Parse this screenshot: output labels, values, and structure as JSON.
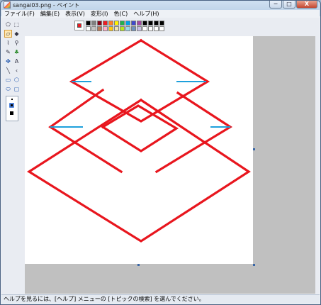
{
  "window": {
    "title": "sangai03.png - ペイント",
    "controls": {
      "minimize": "─",
      "maximize": "□",
      "close": "X"
    }
  },
  "menu": [
    {
      "label": "ファイル(F)"
    },
    {
      "label": "編集(E)"
    },
    {
      "label": "表示(V)"
    },
    {
      "label": "変形(I)"
    },
    {
      "label": "色(C)"
    },
    {
      "label": "ヘルプ(H)"
    }
  ],
  "tools": [
    {
      "name": "free-select-icon",
      "glyph": "⬠"
    },
    {
      "name": "rect-select-icon",
      "glyph": "⬚"
    },
    {
      "name": "eraser-icon",
      "glyph": "▱"
    },
    {
      "name": "fill-icon",
      "glyph": "◆"
    },
    {
      "name": "color-picker-icon",
      "glyph": "⌇"
    },
    {
      "name": "magnifier-icon",
      "glyph": "⚲"
    },
    {
      "name": "pencil-icon",
      "glyph": "✎"
    },
    {
      "name": "brush-icon",
      "glyph": "♣"
    },
    {
      "name": "airbrush-icon",
      "glyph": "✤"
    },
    {
      "name": "text-icon",
      "glyph": "A"
    },
    {
      "name": "line-icon",
      "glyph": "╲"
    },
    {
      "name": "curve-icon",
      "glyph": "‹"
    },
    {
      "name": "rectangle-icon",
      "glyph": "▭"
    },
    {
      "name": "polygon-icon",
      "glyph": "⬡"
    },
    {
      "name": "ellipse-icon",
      "glyph": "⬭"
    },
    {
      "name": "rounded-rect-icon",
      "glyph": "▢"
    }
  ],
  "palette": {
    "foreground": "#ed1c24",
    "colors": [
      "#000000",
      "#7f7f7f",
      "#880015",
      "#ed1c24",
      "#ff7f27",
      "#fff200",
      "#22b14c",
      "#00a2e8",
      "#3f48cc",
      "#a349a4",
      "#000000",
      "#000000",
      "#000000",
      "#000000",
      "#ffffff",
      "#c3c3c3",
      "#b97a57",
      "#ffaec9",
      "#ffc90e",
      "#efe4b0",
      "#b5e61d",
      "#99d9ea",
      "#7092be",
      "#c8bfe7",
      "#ffffff",
      "#ffffff",
      "#ffffff",
      "#ffffff"
    ]
  },
  "drawing": {
    "stroke": "#e8161e",
    "accent": "#1ea0dc"
  },
  "status": {
    "text": "ヘルプを見るには、[ヘルプ] メニューの [トピックの検索] を選んでください。"
  }
}
